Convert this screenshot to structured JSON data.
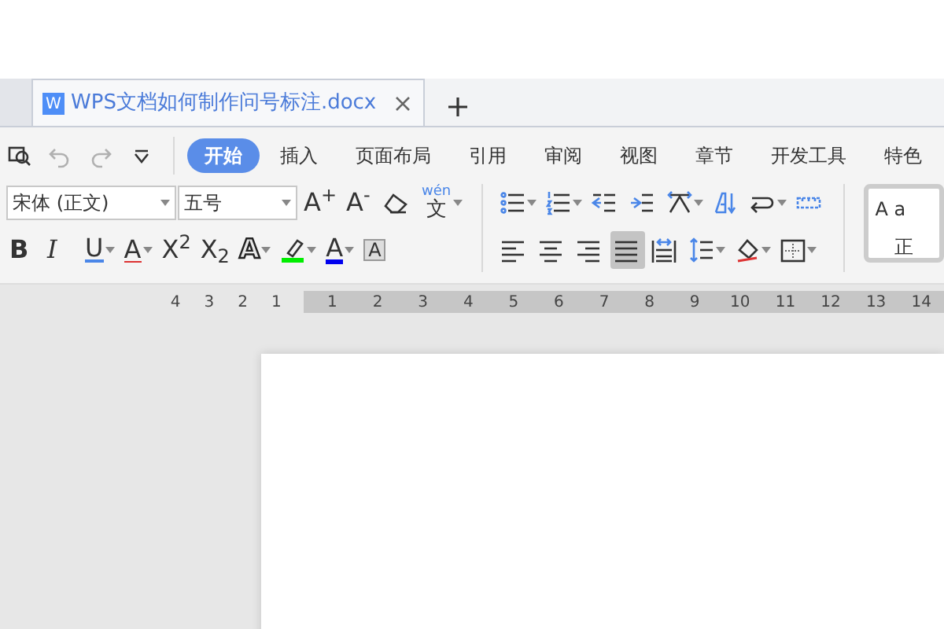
{
  "document_tab": {
    "icon_letter": "W",
    "title": "WPS文档如何制作问号标注.docx"
  },
  "quick_access": [
    {
      "kind": "find",
      "disabled": false
    },
    {
      "kind": "undo",
      "disabled": true
    },
    {
      "kind": "redo",
      "disabled": true
    },
    {
      "kind": "more",
      "disabled": false
    }
  ],
  "ribbon_tabs": [
    {
      "label": "开始",
      "selected": true
    },
    {
      "label": "插入",
      "selected": false
    },
    {
      "label": "页面布局",
      "selected": false
    },
    {
      "label": "引用",
      "selected": false
    },
    {
      "label": "审阅",
      "selected": false
    },
    {
      "label": "视图",
      "selected": false
    },
    {
      "label": "章节",
      "selected": false
    },
    {
      "label": "开发工具",
      "selected": false
    },
    {
      "label": "特色",
      "selected": false
    }
  ],
  "font_name": {
    "value": "宋体 (正文)"
  },
  "font_size": {
    "value": "五号"
  },
  "row1_tools": [
    {
      "kind": "grow",
      "glyph": "A$^{+}$",
      "dropdown": false
    },
    {
      "kind": "shrink",
      "glyph": "A$^{-}$",
      "dropdown": false
    },
    {
      "kind": "eraser",
      "dropdown": false
    },
    {
      "kind": "pinyin",
      "top": "wén",
      "glyph": "文",
      "dropdown": true
    }
  ],
  "row2_tools": [
    {
      "kind": "bold",
      "glyph": "B",
      "dropdown": false
    },
    {
      "kind": "italic",
      "glyph": "I",
      "dropdown": false
    },
    {
      "kind": "underline",
      "glyph": "U",
      "dropdown": true
    },
    {
      "kind": "strike",
      "glyph": "A",
      "dropdown": true
    },
    {
      "kind": "superscript",
      "glyph": "X$^{2}$",
      "dropdown": false
    },
    {
      "kind": "subscript",
      "glyph": "X$_{2}$",
      "dropdown": false
    },
    {
      "kind": "outline",
      "glyph": "A",
      "dropdown": true
    },
    {
      "kind": "highlight",
      "color": "#00ee00",
      "dropdown": true
    },
    {
      "kind": "fontcolor",
      "glyph": "A",
      "color": "#0000ee",
      "dropdown": true
    },
    {
      "kind": "shaded",
      "glyph": "A",
      "dropdown": false
    }
  ],
  "para_row1": [
    {
      "kind": "bullets",
      "dropdown": true,
      "selected": false
    },
    {
      "kind": "numbering",
      "dropdown": true,
      "selected": false
    },
    {
      "kind": "outdent",
      "dropdown": false,
      "selected": false
    },
    {
      "kind": "indent",
      "dropdown": false,
      "selected": false
    },
    {
      "kind": "direction",
      "dropdown": true,
      "selected": false
    },
    {
      "kind": "sort",
      "dropdown": false,
      "selected": false
    },
    {
      "kind": "mark",
      "dropdown": true,
      "selected": false
    },
    {
      "kind": "tabs",
      "dropdown": false,
      "selected": false
    }
  ],
  "para_row2": [
    {
      "kind": "left",
      "dropdown": false,
      "selected": false
    },
    {
      "kind": "center",
      "dropdown": false,
      "selected": false
    },
    {
      "kind": "right",
      "dropdown": false,
      "selected": false
    },
    {
      "kind": "justify",
      "dropdown": false,
      "selected": true
    },
    {
      "kind": "distribute",
      "dropdown": false,
      "selected": false
    },
    {
      "kind": "spacing",
      "dropdown": true,
      "selected": false
    },
    {
      "kind": "shading",
      "dropdown": true,
      "selected": false
    },
    {
      "kind": "borders",
      "dropdown": true,
      "selected": false
    }
  ],
  "style_gallery": {
    "sample": "A a",
    "style_name": "正"
  },
  "ruler": {
    "left_marks": [
      "4",
      "3",
      "2",
      "1"
    ],
    "right_marks": [
      "1",
      "2",
      "3",
      "4",
      "5",
      "6",
      "7",
      "8",
      "9",
      "10",
      "11",
      "12",
      "13",
      "14"
    ]
  }
}
